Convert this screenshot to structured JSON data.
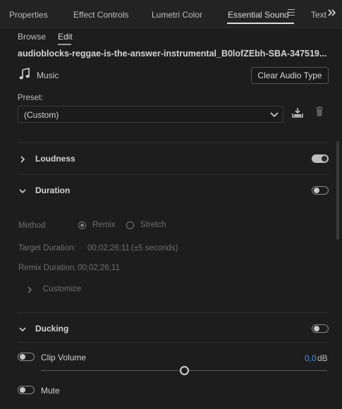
{
  "tabs": [
    {
      "label": "Properties"
    },
    {
      "label": "Effect Controls"
    },
    {
      "label": "Lumetri Color"
    },
    {
      "label": "Essential Sound"
    },
    {
      "label": "Text"
    }
  ],
  "subtabs": {
    "browse": "Browse",
    "edit": "Edit"
  },
  "file_title": "audioblocks-reggae-is-the-answer-instrumental_B0lofZEbh-SBA-347519...",
  "audio_type": {
    "icon": "music-note-icon",
    "label": "Music",
    "clear_button": "Clear Audio Type"
  },
  "preset": {
    "label": "Preset:",
    "value": "(Custom)"
  },
  "sections": {
    "loudness": {
      "title": "Loudness",
      "enabled": true
    },
    "duration": {
      "title": "Duration",
      "enabled": false
    },
    "ducking": {
      "title": "Ducking",
      "enabled": false
    }
  },
  "duration": {
    "method_label": "Method",
    "remix_label": "Remix",
    "stretch_label": "Stretch",
    "target_label": "Target Duration:",
    "target_value": "00;02;26;11",
    "target_note": "(±5 seconds)",
    "remix_label_full": "Remix Duration:",
    "remix_value": "00;02;26;11",
    "customize": "Customize"
  },
  "clip_volume": {
    "label": "Clip Volume",
    "value": "0,0",
    "unit": "dB",
    "enabled": false
  },
  "mute": {
    "label": "Mute",
    "enabled": false
  },
  "colors": {
    "accent_blue": "#4a90e2",
    "background": "#1d1d1d"
  }
}
